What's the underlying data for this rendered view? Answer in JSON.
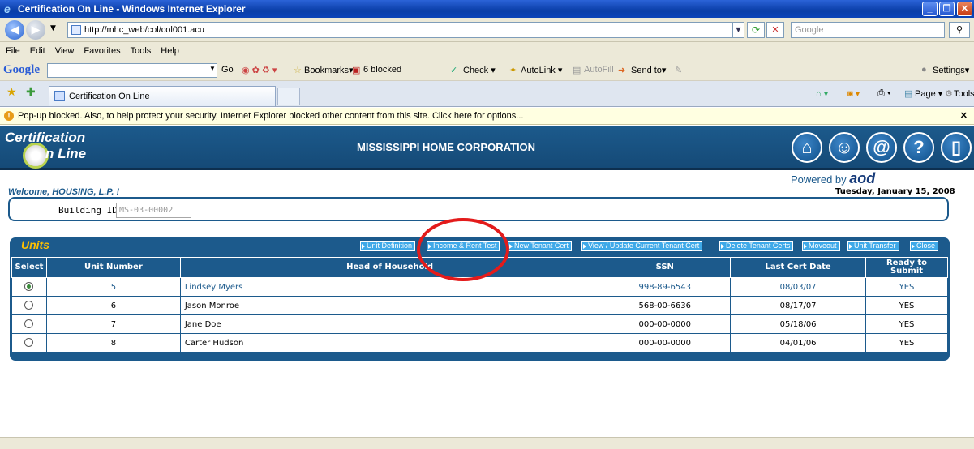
{
  "window": {
    "title": "Certification On Line - Windows Internet Explorer",
    "controls": [
      "_",
      "❐",
      "✕"
    ]
  },
  "address_bar": {
    "url": "http://mhc_web/col/col001.acu",
    "search_placeholder": "Google"
  },
  "menu": {
    "items": [
      "File",
      "Edit",
      "View",
      "Favorites",
      "Tools",
      "Help"
    ]
  },
  "google_toolbar": {
    "logo": "Google",
    "go_label": "Go",
    "bookmarks_label": "Bookmarks▾",
    "blocked_label": "6 blocked",
    "check_label": "Check ▾",
    "autolink_label": "AutoLink ▾",
    "autofill_label": "AutoFill",
    "sendto_label": "Send to▾",
    "settings_label": "Settings▾"
  },
  "tabs": {
    "active_label": "Certification On Line",
    "page_label": "Page ▾",
    "tools_label": "Tools ▾"
  },
  "info_bar": {
    "message": "Pop-up blocked. Also, to help protect your security, Internet Explorer blocked other content from this site. Click here for options..."
  },
  "header": {
    "logo_line1": "Certification",
    "logo_line2": "n Line",
    "org_name": "MISSISSIPPI HOME CORPORATION",
    "powered_by": "Powered by",
    "powered_brand": "aod"
  },
  "welcome": {
    "text": "Welcome, HOUSING, L.P. !",
    "date": "Tuesday, January 15, 2008"
  },
  "building": {
    "label": "Building ID:",
    "value": "MS-03-00002"
  },
  "units": {
    "title": "Units",
    "buttons": [
      "Unit Definition",
      "Income & Rent Test",
      "New Tenant Cert",
      "View / Update Current Tenant Cert",
      "Delete Tenant Certs",
      "Moveout",
      "Unit Transfer",
      "Close"
    ],
    "columns": [
      "Select",
      "Unit Number",
      "Head of Household",
      "SSN",
      "Last Cert Date",
      "Ready to Submit"
    ],
    "rows": [
      {
        "unit": "5",
        "head": "Lindsey Myers",
        "ssn": "998-89-6543",
        "date": "08/03/07",
        "ready": "YES",
        "selected": true
      },
      {
        "unit": "6",
        "head": "Jason Monroe",
        "ssn": "568-00-6636",
        "date": "08/17/07",
        "ready": "YES",
        "selected": false
      },
      {
        "unit": "7",
        "head": "Jane Doe",
        "ssn": "000-00-0000",
        "date": "05/18/06",
        "ready": "YES",
        "selected": false
      },
      {
        "unit": "8",
        "head": "Carter Hudson",
        "ssn": "000-00-0000",
        "date": "04/01/06",
        "ready": "YES",
        "selected": false
      }
    ]
  },
  "colors": {
    "brand_blue": "#1c5a8c",
    "button_blue": "#3fa9e8",
    "units_title": "#ffc000",
    "highlight_red": "#e31b1b"
  }
}
